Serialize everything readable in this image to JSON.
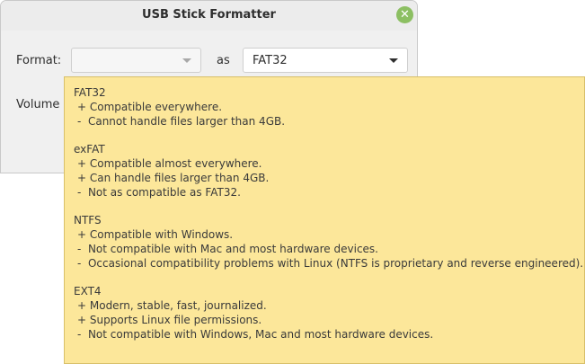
{
  "window": {
    "title": "USB Stick Formatter",
    "close_symbol": "✕"
  },
  "form": {
    "format_label": "Format:",
    "device_value": "",
    "as_label": "as",
    "filesystem_value": "FAT32",
    "volume_label_partial": "Volume l"
  },
  "tooltip": {
    "filesystems": [
      {
        "name": "FAT32",
        "lines": [
          "+ Compatible everywhere.",
          "-  Cannot handle files larger than 4GB."
        ]
      },
      {
        "name": "exFAT",
        "lines": [
          "+ Compatible almost everywhere.",
          "+ Can handle files larger than 4GB.",
          "-  Not as compatible as FAT32."
        ]
      },
      {
        "name": "NTFS",
        "lines": [
          "+ Compatible with Windows.",
          "-  Not compatible with Mac and most hardware devices.",
          "-  Occasional compatibility problems with Linux (NTFS is proprietary and reverse engineered)."
        ]
      },
      {
        "name": "EXT4",
        "lines": [
          "+ Modern, stable, fast, journalized.",
          "+ Supports Linux file permissions.",
          "-  Not compatible with Windows, Mac and most hardware devices."
        ]
      }
    ]
  },
  "colors": {
    "tooltip_bg": "#fce79a",
    "close_button": "#8cbf62"
  }
}
